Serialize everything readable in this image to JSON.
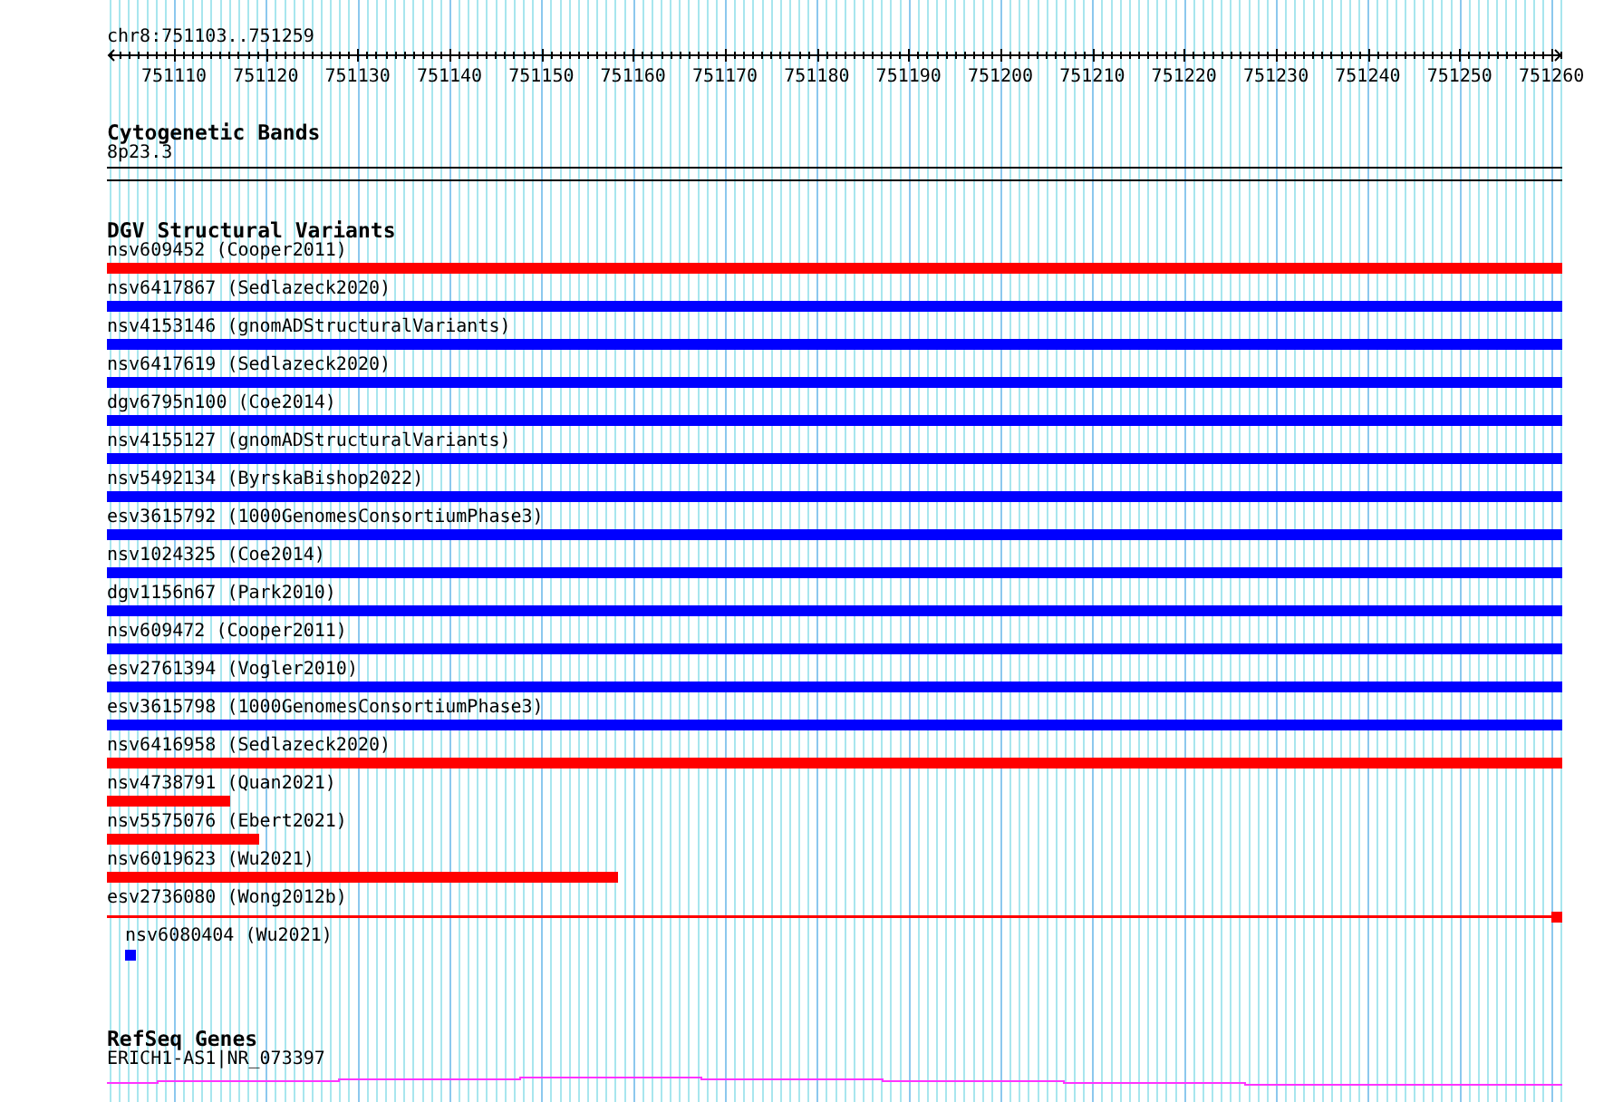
{
  "ruler": {
    "position": "chr8:751103..751259",
    "labels": [
      "751110",
      "751120",
      "751130",
      "751140",
      "751150",
      "751160",
      "751170",
      "751180",
      "751190",
      "751200",
      "751210",
      "751220",
      "751230",
      "751240",
      "751250",
      "751260"
    ]
  },
  "cytoband": {
    "title": "Cytogenetic Bands",
    "label": "8p23.3"
  },
  "variants": {
    "title": "DGV Structural Variants",
    "rows": [
      {
        "label": "nsv609452 (Cooper2011)",
        "kind": "bar",
        "color": "#ff0000",
        "level": 1
      },
      {
        "label": "nsv6417867 (Sedlazeck2020)",
        "kind": "bar",
        "color": "#0000ff",
        "level": 1
      },
      {
        "label": "nsv4153146 (gnomADStructuralVariants)",
        "kind": "bar",
        "color": "#0000ff",
        "level": 1
      },
      {
        "label": "nsv6417619 (Sedlazeck2020)",
        "kind": "bar",
        "color": "#0000ff",
        "level": 1
      },
      {
        "label": "dgv6795n100 (Coe2014)",
        "kind": "bar",
        "color": "#0000ff",
        "level": 1
      },
      {
        "label": "nsv4155127 (gnomADStructuralVariants)",
        "kind": "bar",
        "color": "#0000ff",
        "level": 1
      },
      {
        "label": "nsv5492134 (ByrskaBishop2022)",
        "kind": "bar",
        "color": "#0000ff",
        "level": 1
      },
      {
        "label": "esv3615792 (1000GenomesConsortiumPhase3)",
        "kind": "bar",
        "color": "#0000ff",
        "level": 1
      },
      {
        "label": "nsv1024325 (Coe2014)",
        "kind": "bar",
        "color": "#0000ff",
        "level": 1
      },
      {
        "label": "dgv1156n67 (Park2010)",
        "kind": "bar",
        "color": "#0000ff",
        "level": 1
      },
      {
        "label": "nsv609472 (Cooper2011)",
        "kind": "bar",
        "color": "#0000ff",
        "level": 1
      },
      {
        "label": "esv2761394 (Vogler2010)",
        "kind": "bar",
        "color": "#0000ff",
        "level": 1
      },
      {
        "label": "esv3615798 (1000GenomesConsortiumPhase3)",
        "kind": "bar",
        "color": "#0000ff",
        "level": 1
      },
      {
        "label": "nsv6416958 (Sedlazeck2020)",
        "kind": "bar",
        "color": "#ff0000",
        "level": 1
      },
      {
        "label": "nsv4738791 (Quan2021)",
        "kind": "bar",
        "color": "#ff0000",
        "level": 0.085
      },
      {
        "label": "nsv5575076 (Ebert2021)",
        "kind": "bar",
        "color": "#ff0000",
        "level": 0.105
      },
      {
        "label": "nsv6019623 (Wu2021)",
        "kind": "bar",
        "color": "#ff0000",
        "level": 0.351
      },
      {
        "label": "esv2736080 (Wong2012b)",
        "kind": "line",
        "color": "#ff0000"
      },
      {
        "label": "nsv6080404 (Wu2021)",
        "kind": "insertion",
        "color": "#0000ff"
      }
    ]
  },
  "genes": {
    "title": "RefSeq Genes",
    "label": "ERICH1-AS1|NR_073397"
  }
}
